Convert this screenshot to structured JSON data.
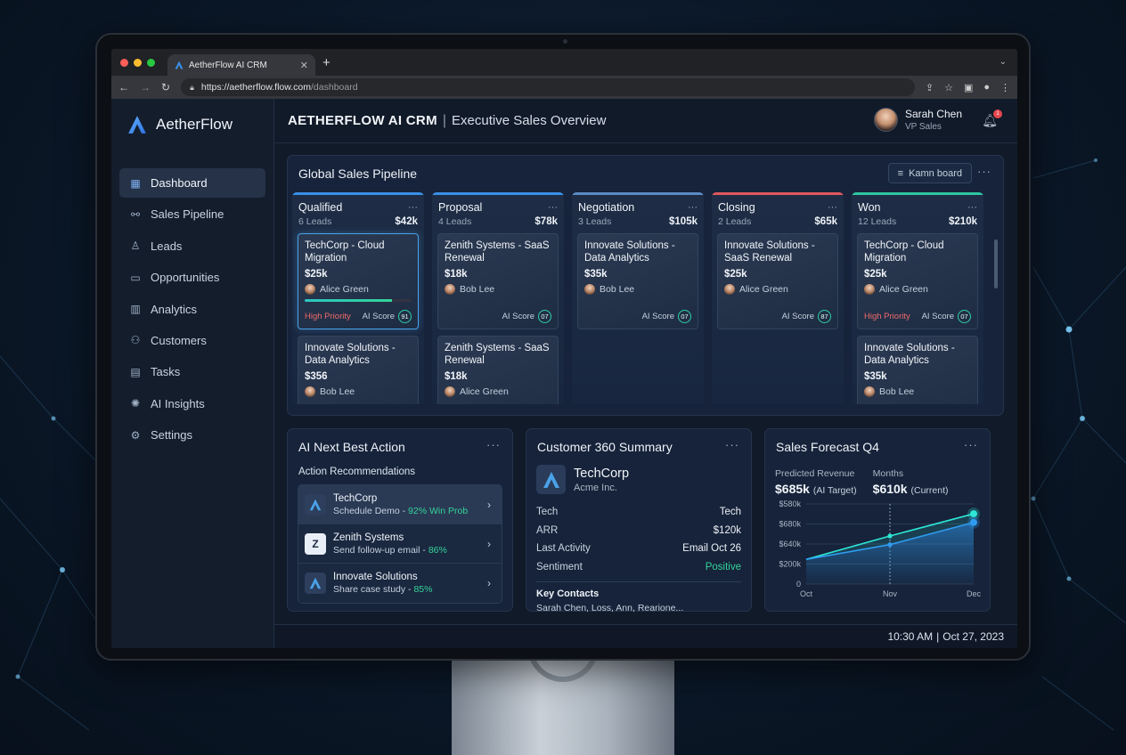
{
  "browser": {
    "tab_title": "AetherFlow AI CRM",
    "url_host": "https://aetherflow.flow.com",
    "url_path": "/dashboard"
  },
  "colors": {
    "accent": "#3b82f6",
    "success": "#34d399",
    "danger": "#ef6a6a",
    "qualified": "#3b8fe6",
    "proposal": "#3b8fe6",
    "negotiation": "#5a8bc4",
    "closing": "#e0585e",
    "won": "#2fc6a1"
  },
  "sidebar": {
    "brand": "AetherFlow",
    "items": [
      {
        "label": "Dashboard",
        "icon": "grid-icon",
        "active": true
      },
      {
        "label": "Sales Pipeline",
        "icon": "pipeline-icon"
      },
      {
        "label": "Leads",
        "icon": "user-icon"
      },
      {
        "label": "Opportunities",
        "icon": "wallet-icon"
      },
      {
        "label": "Analytics",
        "icon": "bar-chart-icon"
      },
      {
        "label": "Customers",
        "icon": "users-icon"
      },
      {
        "label": "Tasks",
        "icon": "clipboard-icon"
      },
      {
        "label": "AI Insights",
        "icon": "lightbulb-icon"
      },
      {
        "label": "Settings",
        "icon": "gear-icon"
      }
    ]
  },
  "header": {
    "title": "AETHERFLOW AI CRM",
    "separator": "|",
    "subtitle": "Executive Sales Overview",
    "user_name": "Sarah Chen",
    "user_role": "VP Sales",
    "notifications": "1"
  },
  "pipeline": {
    "title": "Global Sales Pipeline",
    "board_button": "Kamn board",
    "columns": [
      {
        "name": "Qualified",
        "leads": "6 Leads",
        "amount": "$42k",
        "deals": [
          {
            "name": "TechCorp - Cloud Migration",
            "amount": "$25k",
            "owner": "Alice Green",
            "priority": "High Priority",
            "score_label": "AI Score",
            "score": "91",
            "progress": 0.82
          },
          {
            "name": "Innovate Solutions - Data Analytics",
            "amount": "$356",
            "owner": "Bob Lee"
          }
        ]
      },
      {
        "name": "Proposal",
        "leads": "4 Leads",
        "amount": "$78k",
        "deals": [
          {
            "name": "Zenith Systems - SaaS Renewal",
            "amount": "$18k",
            "owner": "Bob Lee",
            "score_label": "AI Score",
            "score": "07"
          },
          {
            "name": "Zenith Systems - SaaS Renewal",
            "amount": "$18k",
            "owner": "Alice Green"
          }
        ]
      },
      {
        "name": "Negotiation",
        "leads": "3 Leads",
        "amount": "$105k",
        "deals": [
          {
            "name": "Innovate Solutions - Data Analytics",
            "amount": "$35k",
            "owner": "Bob Lee",
            "score_label": "AI Score",
            "score": "07"
          }
        ]
      },
      {
        "name": "Closing",
        "leads": "2 Leads",
        "amount": "$65k",
        "deals": [
          {
            "name": "Innovate Solutions - SaaS Renewal",
            "amount": "$25k",
            "owner": "Alice Green",
            "score_label": "AI Score",
            "score": "87"
          }
        ]
      },
      {
        "name": "Won",
        "leads": "12 Leads",
        "amount": "$210k",
        "deals": [
          {
            "name": "TechCorp - Cloud Migration",
            "amount": "$25k",
            "owner": "Alice Green",
            "priority": "High Priority",
            "score_label": "AI Score",
            "score": "07"
          },
          {
            "name": "Innovate Solutions - Data Analytics",
            "amount": "$35k",
            "owner": "Bob Lee"
          }
        ]
      }
    ]
  },
  "nba": {
    "title": "AI Next Best Action",
    "subtitle": "Action Recommendations",
    "items": [
      {
        "company": "TechCorp",
        "action": "Schedule Demo - ",
        "pct": "92% Win Prob",
        "logo": "A"
      },
      {
        "company": "Zenith Systems",
        "action": "Send follow-up email - ",
        "pct": "86%",
        "logo": "Z"
      },
      {
        "company": "Innovate Solutions",
        "action": "Share case study - ",
        "pct": "85%",
        "logo": "A"
      }
    ]
  },
  "c360": {
    "title": "Customer 360 Summary",
    "company": "TechCorp",
    "parent": "Acme Inc.",
    "rows": [
      {
        "k": "Tech",
        "v": "Tech"
      },
      {
        "k": "ARR",
        "v": "$120k"
      },
      {
        "k": "Last Activity",
        "v": "Email Oct 26"
      },
      {
        "k": "Sentiment",
        "v": "Positive"
      }
    ],
    "contacts_title": "Key Contacts",
    "contacts": "Sarah Chen, Loss, Ann, Rearione..."
  },
  "forecast": {
    "title": "Sales Forecast Q4",
    "m1_label": "Predicted Revenue",
    "m1_value": "$685k",
    "m1_note": "(AI Target)",
    "m2_label": "Months",
    "m2_value": "$610k",
    "m2_note": "(Current)"
  },
  "chart_data": {
    "type": "line",
    "categories": [
      "Oct",
      "Nov",
      "Dec"
    ],
    "y_ticks": [
      "$580k",
      "$680k",
      "$640k",
      "$200k",
      "0"
    ],
    "series": [
      {
        "values": [
          200,
          390,
          570
        ],
        "color": "#2ee6d6"
      },
      {
        "values": [
          200,
          320,
          500
        ],
        "color": "#2f9cf0"
      }
    ],
    "ylim": [
      0,
      650
    ],
    "grid": true
  },
  "status": {
    "time": "10:30 AM",
    "sep": "|",
    "date": "Oct 27, 2023"
  }
}
